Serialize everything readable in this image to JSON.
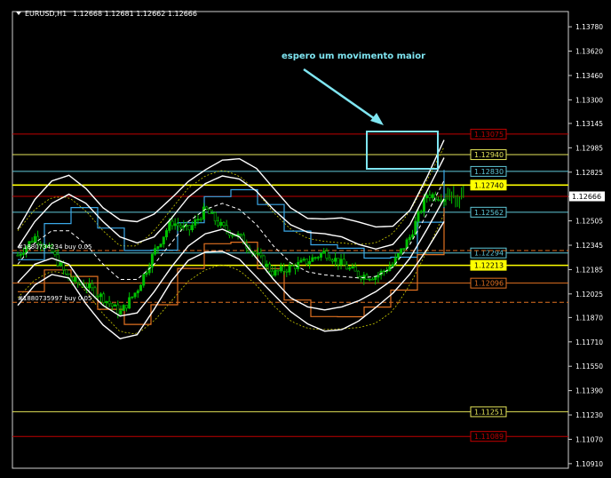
{
  "header": {
    "symbol_label": "EURUSD,H1",
    "ohlc_text": "1.12668 1.12681 1.12662 1.12666"
  },
  "annotation": {
    "text": "espero um movimento maior"
  },
  "order_labels": [
    {
      "text": "#1880734234 buy 0.05",
      "price": 1.1231
    },
    {
      "text": "#1880735997 buy 0.05",
      "price": 1.1197
    }
  ],
  "colors": {
    "background": "#000000",
    "candle_up": "#00c000",
    "band": "#ffffff",
    "level_red": "#c00000",
    "level_yellow": "#e6e65a",
    "level_cyan": "#5fc8d8",
    "level_orange": "#e07020",
    "annotation": "#7fe6f2",
    "bid_line": "#c0c0c0",
    "frame": "#cfcfcf"
  },
  "chart_data": {
    "type": "candlestick",
    "symbol": "EURUSD",
    "timeframe": "H1",
    "ylim": [
      1.1088,
      1.1388
    ],
    "y_ticks": [
      1.1378,
      1.1362,
      1.1346,
      1.133,
      1.13145,
      1.12985,
      1.12825,
      1.12665,
      1.12505,
      1.12345,
      1.12185,
      1.12025,
      1.1187,
      1.1171,
      1.1155,
      1.1139,
      1.1123,
      1.1107,
      1.1091
    ],
    "current_price": 1.12666,
    "series": [
      {
        "name": "upper_band",
        "values": [
          1.1233,
          1.125,
          1.1262,
          1.1268,
          1.1262,
          1.125,
          1.124,
          1.1236,
          1.124,
          1.1252,
          1.1266,
          1.1275,
          1.128,
          1.1278,
          1.127,
          1.1258,
          1.1248,
          1.1243,
          1.1242,
          1.124,
          1.1235,
          1.1232,
          1.1235,
          1.1248,
          1.127,
          1.1292
        ]
      },
      {
        "name": "middle_band",
        "values": [
          1.1222,
          1.1236,
          1.1244,
          1.1244,
          1.1235,
          1.1222,
          1.1212,
          1.1212,
          1.1222,
          1.1236,
          1.125,
          1.1258,
          1.1262,
          1.1258,
          1.1248,
          1.1234,
          1.1223,
          1.1217,
          1.1215,
          1.1214,
          1.1213,
          1.1214,
          1.122,
          1.1235,
          1.1255,
          1.1277
        ]
      },
      {
        "name": "lower_band",
        "values": [
          1.121,
          1.1222,
          1.1226,
          1.1222,
          1.1206,
          1.1195,
          1.1188,
          1.119,
          1.1204,
          1.122,
          1.1234,
          1.1242,
          1.1245,
          1.124,
          1.1226,
          1.1212,
          1.12,
          1.1194,
          1.1192,
          1.1194,
          1.1198,
          1.1204,
          1.1212,
          1.1226,
          1.1245,
          1.1265
        ]
      },
      {
        "name": "close",
        "values": [
          1.1228,
          1.124,
          1.123,
          1.1212,
          1.1208,
          1.12,
          1.119,
          1.1205,
          1.123,
          1.125,
          1.1244,
          1.1258,
          1.1246,
          1.124,
          1.1228,
          1.1216,
          1.122,
          1.1224,
          1.123,
          1.1222,
          1.1215,
          1.1214,
          1.1222,
          1.124,
          1.1268,
          1.1266
        ]
      }
    ],
    "levels": [
      {
        "price": 1.13075,
        "label": "1.13075",
        "color": "red"
      },
      {
        "price": 1.1294,
        "label": "1.12940",
        "color": "yellow"
      },
      {
        "price": 1.1283,
        "label": "1.12830",
        "color": "cyan"
      },
      {
        "price": 1.1274,
        "label": "1.12740",
        "color": "yellow-bright"
      },
      {
        "price": 1.12562,
        "label": "1.12562",
        "color": "cyan"
      },
      {
        "price": 1.12294,
        "label": "1.12294",
        "color": "cyan"
      },
      {
        "price": 1.12213,
        "label": "1.12213",
        "color": "yellow-bright"
      },
      {
        "price": 1.12096,
        "label": "1.12096",
        "color": "orange"
      },
      {
        "price": 1.11251,
        "label": "1.11251",
        "color": "yellow"
      },
      {
        "price": 1.11089,
        "label": "1.11089",
        "color": "red"
      }
    ],
    "grid": false
  }
}
